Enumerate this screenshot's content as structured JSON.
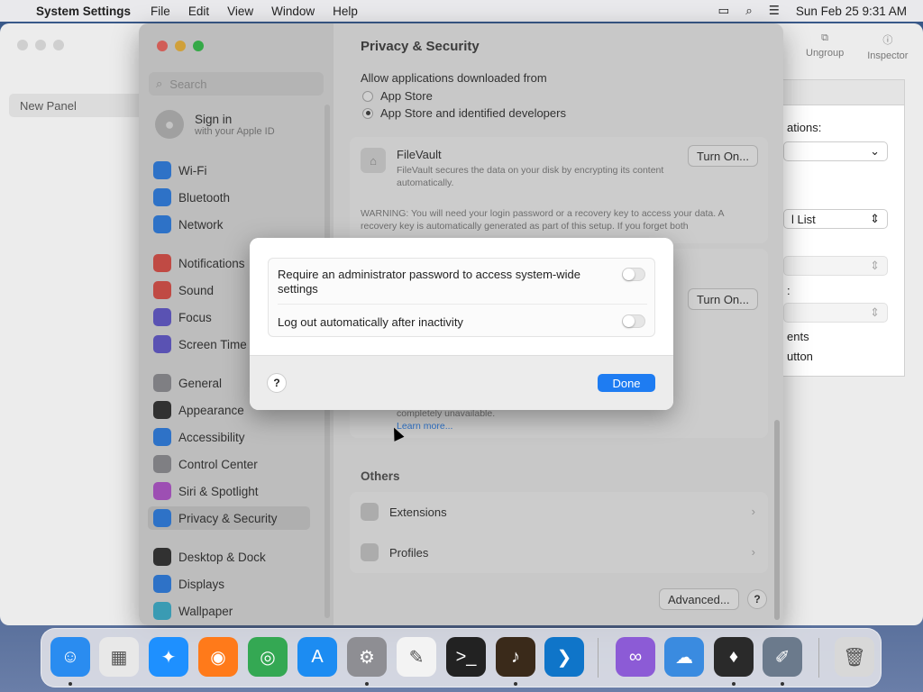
{
  "menubar": {
    "app_name": "System Settings",
    "items": [
      "File",
      "Edit",
      "View",
      "Window",
      "Help"
    ],
    "datetime": "Sun Feb 25  9:31 AM"
  },
  "background_window": {
    "sidebar_item": "New Panel",
    "toolbar": {
      "ungroup": "Ungroup",
      "inspector": "Inspector"
    },
    "inspector": {
      "label1": "ations:",
      "select2": "l List",
      "label3": ":",
      "text4": "ents",
      "text5": "utton"
    }
  },
  "settings": {
    "search_placeholder": "Search",
    "signin": {
      "title": "Sign in",
      "subtitle": "with your Apple ID"
    },
    "sidebar": [
      {
        "label": "Wi-Fi",
        "icon": "wifi-icon",
        "color": "#1e7cf2"
      },
      {
        "label": "Bluetooth",
        "icon": "bluetooth-icon",
        "color": "#1e7cf2"
      },
      {
        "label": "Network",
        "icon": "globe-icon",
        "color": "#1e7cf2"
      },
      {
        "label": "Notifications",
        "icon": "bell-icon",
        "color": "#e8453c"
      },
      {
        "label": "Sound",
        "icon": "speaker-icon",
        "color": "#e8453c"
      },
      {
        "label": "Focus",
        "icon": "moon-icon",
        "color": "#5b4fd6"
      },
      {
        "label": "Screen Time",
        "icon": "hourglass-icon",
        "color": "#5b4fd6"
      },
      {
        "label": "General",
        "icon": "gear-icon",
        "color": "#8e8e93"
      },
      {
        "label": "Appearance",
        "icon": "appearance-icon",
        "color": "#222222"
      },
      {
        "label": "Accessibility",
        "icon": "accessibility-icon",
        "color": "#1e7cf2"
      },
      {
        "label": "Control Center",
        "icon": "control-center-icon",
        "color": "#8e8e93"
      },
      {
        "label": "Siri & Spotlight",
        "icon": "siri-icon",
        "color": "#b84bd6"
      },
      {
        "label": "Privacy & Security",
        "icon": "hand-icon",
        "color": "#1e7cf2"
      },
      {
        "label": "Desktop & Dock",
        "icon": "dock-icon",
        "color": "#222222"
      },
      {
        "label": "Displays",
        "icon": "display-icon",
        "color": "#1e7cf2"
      },
      {
        "label": "Wallpaper",
        "icon": "wallpaper-icon",
        "color": "#2fb5d6"
      }
    ],
    "main": {
      "title": "Privacy & Security",
      "allow_label": "Allow applications downloaded from",
      "radio1": "App Store",
      "radio2": "App Store and identified developers",
      "filevault_title": "FileVault",
      "filevault_desc": "FileVault secures the data on your disk by encrypting its content automatically.",
      "turn_on": "Turn On...",
      "warning": "WARNING: You will need your login password or a recovery key to access your data. A recovery key is automatically generated as part of this setup. If you forget both",
      "turn_on2": "Turn On...",
      "unavailable": "completely unavailable.",
      "learn_more": "Learn more...",
      "others_title": "Others",
      "extensions": "Extensions",
      "profiles": "Profiles",
      "advanced": "Advanced...",
      "help": "?"
    }
  },
  "modal": {
    "option1": "Require an administrator password to access system-wide settings",
    "option1_enabled": false,
    "option2": "Log out automatically after inactivity",
    "option2_enabled": false,
    "help": "?",
    "done": "Done"
  },
  "dock": [
    {
      "name": "finder-icon",
      "color": "#2a8cf0",
      "glyph": "☺"
    },
    {
      "name": "launchpad-icon",
      "color": "#e8e8e8",
      "glyph": "▦"
    },
    {
      "name": "safari-icon",
      "color": "#1e90ff",
      "glyph": "✦"
    },
    {
      "name": "firefox-icon",
      "color": "#ff7a1a",
      "glyph": "◉"
    },
    {
      "name": "chrome-icon",
      "color": "#34a853",
      "glyph": "◎"
    },
    {
      "name": "app-store-icon",
      "color": "#1c8cf2",
      "glyph": "A"
    },
    {
      "name": "system-settings-icon",
      "color": "#8e8e93",
      "glyph": "⚙"
    },
    {
      "name": "textedit-icon",
      "color": "#f3f3f3",
      "glyph": "✎"
    },
    {
      "name": "terminal-icon",
      "color": "#222222",
      "glyph": ">_"
    },
    {
      "name": "garageband-icon",
      "color": "#3a2a1a",
      "glyph": "♪"
    },
    {
      "name": "vscode-icon",
      "color": "#0f75c9",
      "glyph": "❯"
    },
    {
      "name": "visual-studio-icon",
      "color": "#8c5bd6",
      "glyph": "∞"
    },
    {
      "name": "weather-icon",
      "color": "#3a8be0",
      "glyph": "☁"
    },
    {
      "name": "bartender-icon",
      "color": "#2a2a2a",
      "glyph": "♦"
    },
    {
      "name": "script-editor-icon",
      "color": "#6b7a8c",
      "glyph": "✐"
    },
    {
      "name": "trash-icon",
      "color": "#d8d8d8",
      "glyph": "🗑"
    }
  ]
}
